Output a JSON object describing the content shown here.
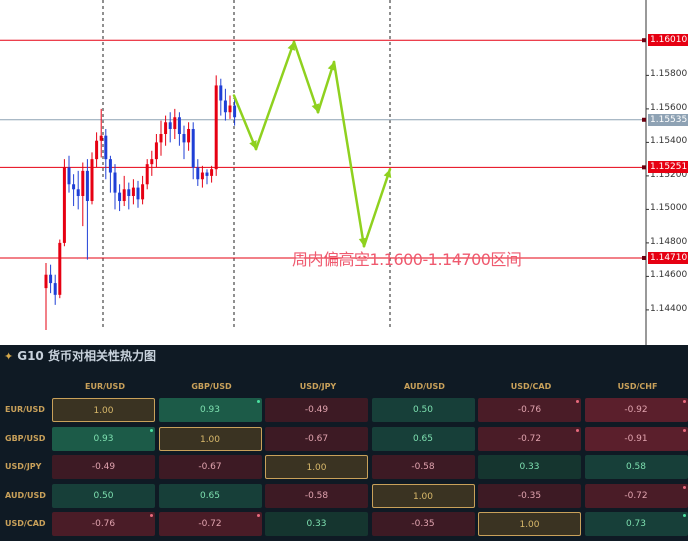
{
  "chart_data": [
    {
      "type": "candlestick",
      "y_ticks": [
        "1.15800",
        "1.15600",
        "1.15400",
        "1.15200",
        "1.15000",
        "1.14800",
        "1.14600",
        "1.14400"
      ],
      "y_tick_values": [
        1.158,
        1.156,
        1.154,
        1.152,
        1.15,
        1.148,
        1.146,
        1.144
      ],
      "ylim": [
        1.1428,
        1.1625
      ],
      "grid": false,
      "horizontal_levels": [
        {
          "label": "1.16010",
          "value": 1.1601,
          "color": "#e60012"
        },
        {
          "label": "1.15535",
          "value": 1.15535,
          "color": "#8ea2b4"
        },
        {
          "label": "1.15251",
          "value": 1.15251,
          "color": "#e60012"
        },
        {
          "label": "1.14710",
          "value": 1.1471,
          "color": "#e60012"
        }
      ],
      "annotation": "周内偏高空1.1600-1.14700区间",
      "candles": [
        [
          1.1453,
          1.1461,
          1.1428,
          1.1468
        ],
        [
          1.1461,
          1.1456,
          1.145,
          1.1467
        ],
        [
          1.1456,
          1.1449,
          1.1443,
          1.1461
        ],
        [
          1.1449,
          1.148,
          1.1447,
          1.1482
        ],
        [
          1.148,
          1.1525,
          1.1478,
          1.153
        ],
        [
          1.1525,
          1.1515,
          1.151,
          1.1532
        ],
        [
          1.1515,
          1.1512,
          1.1502,
          1.1521
        ],
        [
          1.1512,
          1.1508,
          1.15,
          1.1523
        ],
        [
          1.1508,
          1.1523,
          1.149,
          1.1528
        ],
        [
          1.1523,
          1.1505,
          1.147,
          1.153
        ],
        [
          1.1505,
          1.153,
          1.1503,
          1.1534
        ],
        [
          1.153,
          1.1541,
          1.1525,
          1.1546
        ],
        [
          1.1541,
          1.1544,
          1.1531,
          1.156
        ],
        [
          1.1544,
          1.153,
          1.1518,
          1.1548
        ],
        [
          1.153,
          1.1522,
          1.151,
          1.1532
        ],
        [
          1.1522,
          1.151,
          1.15,
          1.1527
        ],
        [
          1.151,
          1.1505,
          1.1499,
          1.1515
        ],
        [
          1.1505,
          1.1512,
          1.1502,
          1.152
        ],
        [
          1.1512,
          1.1508,
          1.15,
          1.1516
        ],
        [
          1.1508,
          1.1513,
          1.1503,
          1.1518
        ],
        [
          1.1513,
          1.1506,
          1.1501,
          1.1517
        ],
        [
          1.1506,
          1.1515,
          1.1503,
          1.152
        ],
        [
          1.1515,
          1.1527,
          1.1512,
          1.153
        ],
        [
          1.1527,
          1.153,
          1.152,
          1.1535
        ],
        [
          1.153,
          1.154,
          1.1525,
          1.1545
        ],
        [
          1.154,
          1.1545,
          1.1532,
          1.1553
        ],
        [
          1.1545,
          1.1552,
          1.1538,
          1.1556
        ],
        [
          1.1552,
          1.1548,
          1.154,
          1.1558
        ],
        [
          1.1548,
          1.1555,
          1.1542,
          1.156
        ],
        [
          1.1555,
          1.1545,
          1.1538,
          1.1558
        ],
        [
          1.1545,
          1.154,
          1.153,
          1.155
        ],
        [
          1.154,
          1.1548,
          1.1535,
          1.1552
        ],
        [
          1.1548,
          1.1525,
          1.1518,
          1.1552
        ],
        [
          1.1525,
          1.1518,
          1.1514,
          1.153
        ],
        [
          1.1518,
          1.1522,
          1.1513,
          1.1526
        ],
        [
          1.1522,
          1.152,
          1.1515,
          1.1524
        ],
        [
          1.152,
          1.1524,
          1.1516,
          1.1526
        ],
        [
          1.1524,
          1.1574,
          1.152,
          1.158
        ],
        [
          1.1574,
          1.1565,
          1.1556,
          1.1578
        ],
        [
          1.1565,
          1.1558,
          1.1553,
          1.1572
        ],
        [
          1.1558,
          1.1562,
          1.1554,
          1.1568
        ],
        [
          1.1562,
          1.1555,
          1.155,
          1.1566
        ]
      ],
      "forecast_path": [
        [
          1.1568,
          0
        ],
        [
          1.1536,
          1
        ],
        [
          1.16,
          2
        ],
        [
          1.1558,
          3
        ],
        [
          1.1588,
          4
        ],
        [
          1.1478,
          5
        ],
        [
          1.1524,
          6
        ]
      ]
    },
    {
      "type": "heatmap",
      "title": "G10 货币对相关性热力图",
      "columns": [
        "EUR/USD",
        "GBP/USD",
        "USD/JPY",
        "AUD/USD",
        "USD/CAD",
        "USD/CHF"
      ],
      "rows": [
        {
          "label": "EUR/USD",
          "values": [
            "1.00",
            "0.93",
            "-0.49",
            "0.50",
            "-0.76",
            "-0.92"
          ]
        },
        {
          "label": "GBP/USD",
          "values": [
            "0.93",
            "1.00",
            "-0.67",
            "0.65",
            "-0.72",
            "-0.91"
          ]
        },
        {
          "label": "USD/JPY",
          "values": [
            "-0.49",
            "-0.67",
            "1.00",
            "-0.58",
            "0.33",
            "0.58"
          ]
        },
        {
          "label": "AUD/USD",
          "values": [
            "0.50",
            "0.65",
            "-0.58",
            "1.00",
            "-0.35",
            "-0.72"
          ]
        },
        {
          "label": "USD/CAD",
          "values": [
            "-0.76",
            "-0.72",
            "0.33",
            "-0.35",
            "1.00",
            "0.73"
          ]
        }
      ],
      "colors": {
        "strong_positive": "#1c5b48",
        "positive": "#173f39",
        "weak_positive": "#15352f",
        "strong_negative": "#5b1f2c",
        "negative": "#3d1a24",
        "diagonal": "#3a3322",
        "positive_text": "#7ee0b0",
        "negative_text": "#e0a3ae",
        "diag_text": "#d9b96b",
        "marker_green": "#4be0a0",
        "marker_red": "#e86a7d"
      }
    }
  ]
}
